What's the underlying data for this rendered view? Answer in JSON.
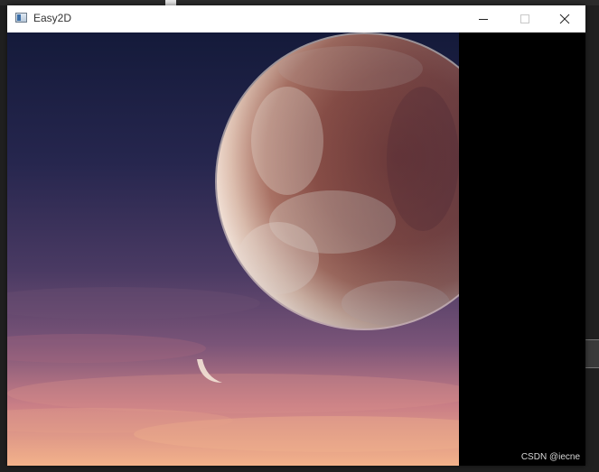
{
  "window": {
    "title": "Easy2D"
  },
  "titlebar": {
    "icon": "application-window-icon",
    "controls": {
      "minimize_icon": "minimize-icon",
      "maximize_icon": "maximize-icon",
      "close_icon": "close-icon"
    }
  },
  "scene": {
    "description_icon": "planet-sky-image"
  },
  "watermark": {
    "text": "CSDN @iecne"
  },
  "colors": {
    "titlebar_bg": "#ffffff",
    "client_bg": "#000000",
    "sky_top": "#141a3a",
    "sky_bottom": "#f3b28a"
  }
}
